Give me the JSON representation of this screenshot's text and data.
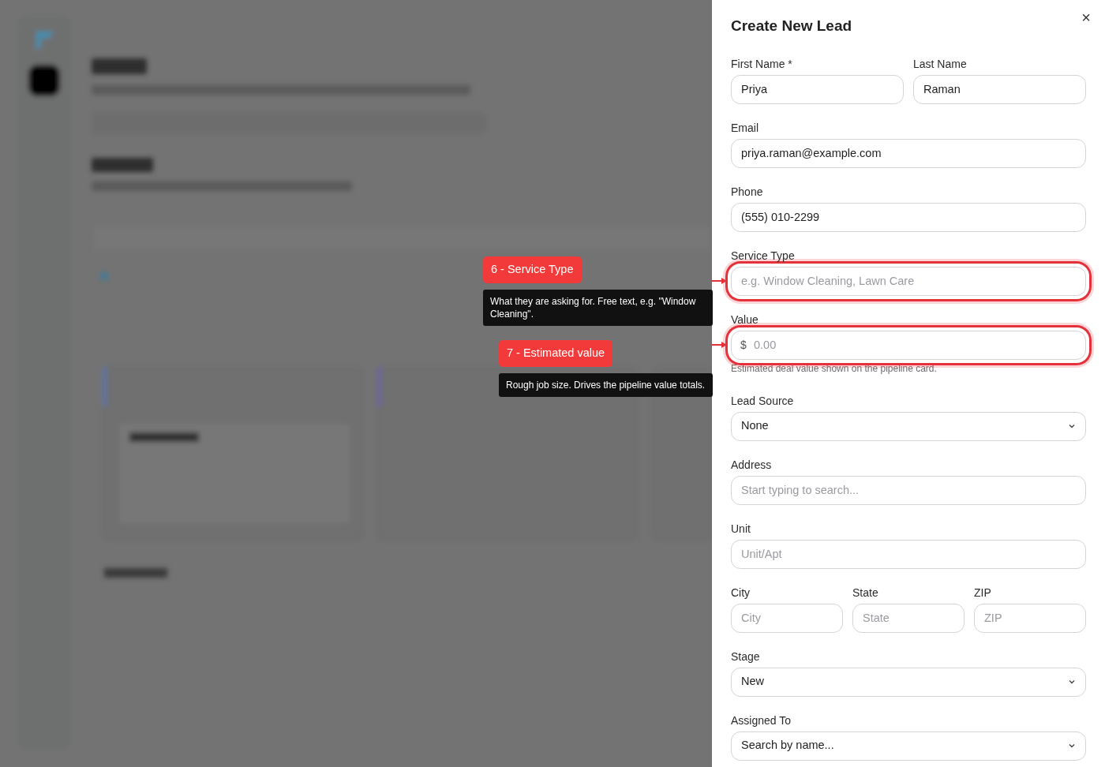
{
  "panel": {
    "title": "Create New Lead",
    "close": "×"
  },
  "rows": [
    [
      {
        "kind": "input",
        "label": "First Name *",
        "value": "Priya",
        "highlighted": false
      },
      {
        "kind": "input",
        "label": "Last Name",
        "value": "Raman",
        "highlighted": false
      }
    ],
    [
      {
        "kind": "input",
        "label": "Email",
        "value": "priya.raman@example.com",
        "highlighted": false
      }
    ],
    [
      {
        "kind": "input",
        "label": "Phone",
        "value": "(555) 010-2299",
        "highlighted": false
      }
    ],
    [
      {
        "kind": "input",
        "label": "Service Type",
        "placeholder": "e.g. Window Cleaning, Lawn Care",
        "highlighted": true
      }
    ],
    [
      {
        "kind": "money",
        "label": "Value",
        "prefix": "$",
        "placeholder": "0.00",
        "help": "Estimated deal value shown on the pipeline card.",
        "highlighted": true
      }
    ],
    [
      {
        "kind": "select",
        "label": "Lead Source",
        "value": "None",
        "highlighted": false
      }
    ],
    [
      {
        "kind": "input",
        "label": "Address",
        "placeholder": "Start typing to search...",
        "highlighted": false
      }
    ],
    [
      {
        "kind": "input",
        "label": "Unit",
        "placeholder": "Unit/Apt",
        "highlighted": false
      }
    ],
    [
      {
        "kind": "input",
        "label": "City",
        "placeholder": "City",
        "highlighted": false
      },
      {
        "kind": "input",
        "label": "State",
        "placeholder": "State",
        "highlighted": false
      },
      {
        "kind": "input",
        "label": "ZIP",
        "placeholder": "ZIP",
        "highlighted": false
      }
    ],
    [
      {
        "kind": "select",
        "label": "Stage",
        "value": "New",
        "highlighted": false
      }
    ],
    [
      {
        "kind": "select",
        "label": "Assigned To",
        "value": "Search by name...",
        "highlighted": false
      }
    ]
  ],
  "callouts": [
    {
      "badge": "6 - Service Type",
      "note": "What they are asking for. Free text, e.g. \"Window Cleaning\"."
    },
    {
      "badge": "7 - Estimated value",
      "note": "Rough job size. Drives the pipeline value totals."
    }
  ]
}
